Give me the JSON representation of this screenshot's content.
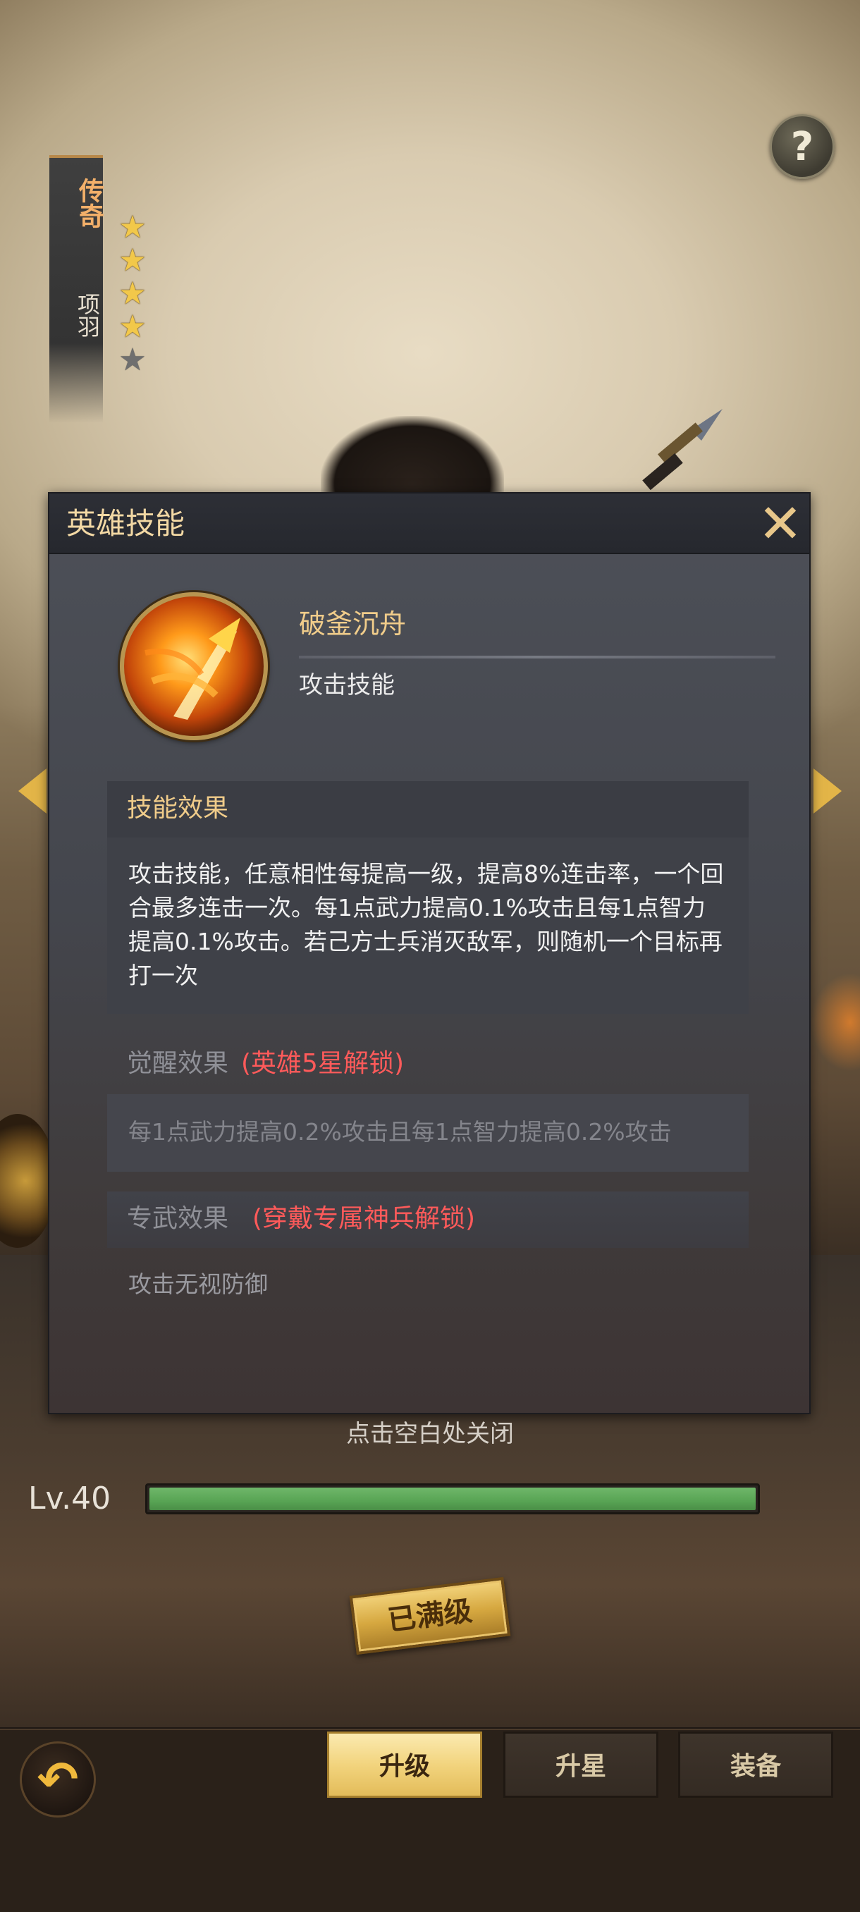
{
  "hero": {
    "rank": "传奇",
    "name": "项羽",
    "stars_total": 5,
    "stars_filled": 4
  },
  "help": {
    "label": "?"
  },
  "dialog": {
    "title": "英雄技能",
    "close_label": "✕",
    "skill": {
      "name": "破釜沉舟",
      "type": "攻击技能"
    },
    "effect": {
      "heading": "技能效果",
      "text": "攻击技能，任意相性每提高一级，提高8%连击率，一个回合最多连击一次。每1点武力提高0.1%攻击且每1点智力提高0.1%攻击。若己方士兵消灭敌军，则随机一个目标再打一次"
    },
    "awaken": {
      "heading": "觉醒效果",
      "lock": "(英雄5星解锁)",
      "text": "每1点武力提高0.2%攻击且每1点智力提高0.2%攻击"
    },
    "weapon": {
      "heading": "专武效果",
      "lock": "(穿戴专属神兵解锁)",
      "text": "攻击无视防御"
    }
  },
  "close_hint": "点击空白处关闭",
  "level": {
    "label": "Lv.40",
    "progress": 1.0
  },
  "max_badge": "已满级",
  "tabs": [
    {
      "label": "升级",
      "active": true
    },
    {
      "label": "升星",
      "active": false
    },
    {
      "label": "装备",
      "active": false
    }
  ],
  "colors": {
    "accent_gold": "#f0cc8a",
    "lock_red": "#ff5a5a",
    "level_green": "#58a454",
    "star_gold": "#f2c84a"
  }
}
